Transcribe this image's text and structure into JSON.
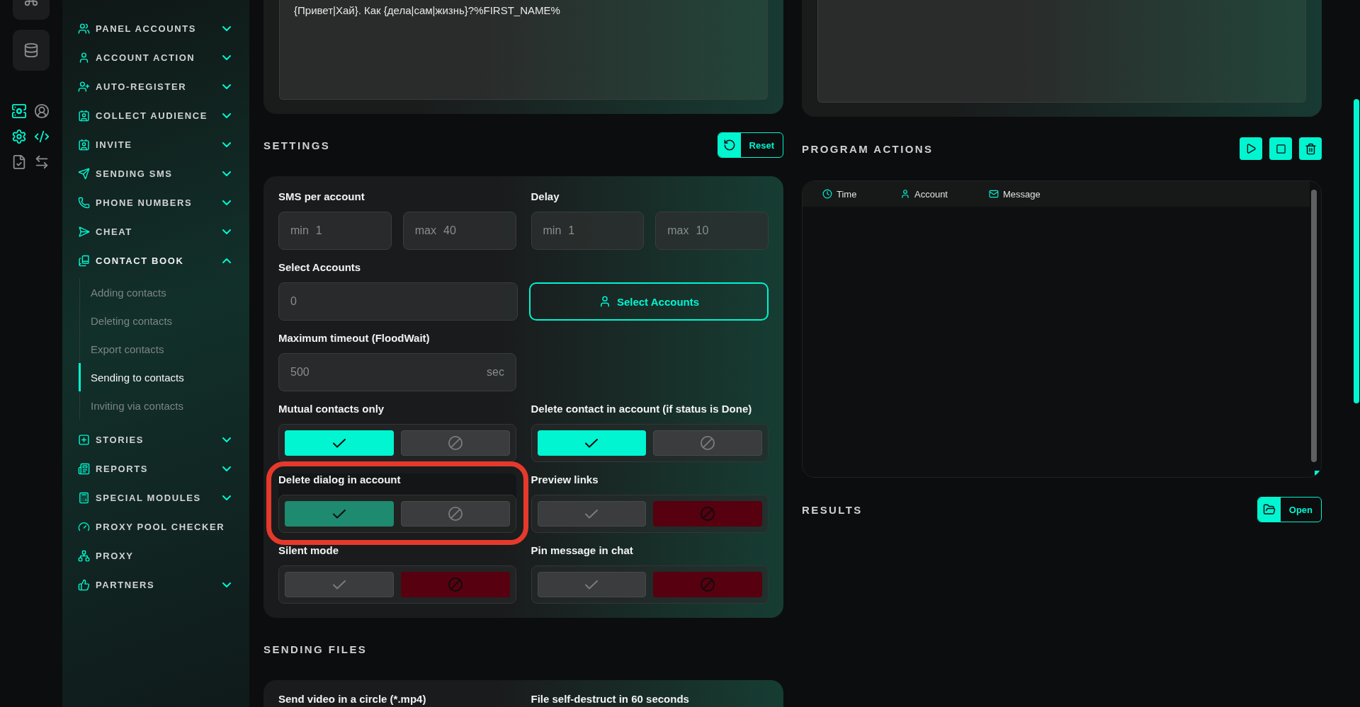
{
  "rail": {
    "icons": [
      {
        "active": false
      },
      {
        "active": false
      },
      {
        "active": true
      },
      {
        "active": false
      },
      {
        "active": true
      },
      {
        "active": true
      },
      {
        "active": false
      },
      {
        "active": false
      }
    ]
  },
  "sidebar": {
    "items": [
      {
        "label": "PANEL ACCOUNTS",
        "expandable": true,
        "expanded": false
      },
      {
        "label": "ACCOUNT ACTION",
        "expandable": true,
        "expanded": false
      },
      {
        "label": "AUTO-REGISTER",
        "expandable": true,
        "expanded": false
      },
      {
        "label": "COLLECT AUDIENCE",
        "expandable": true,
        "expanded": false
      },
      {
        "label": "INVITE",
        "expandable": true,
        "expanded": false
      },
      {
        "label": "SENDING SMS",
        "expandable": true,
        "expanded": false
      },
      {
        "label": "PHONE NUMBERS",
        "expandable": true,
        "expanded": false
      },
      {
        "label": "CHEAT",
        "expandable": true,
        "expanded": false
      },
      {
        "label": "CONTACT BOOK",
        "expandable": true,
        "expanded": true,
        "children": [
          {
            "label": "Adding contacts",
            "selected": false
          },
          {
            "label": "Deleting contacts",
            "selected": false
          },
          {
            "label": "Export contacts",
            "selected": false
          },
          {
            "label": "Sending to contacts",
            "selected": true
          },
          {
            "label": "Inviting via contacts",
            "selected": false
          }
        ]
      },
      {
        "label": "STORIES",
        "expandable": true,
        "expanded": false
      },
      {
        "label": "REPORTS",
        "expandable": true,
        "expanded": false
      },
      {
        "label": "SPECIAL MODULES",
        "expandable": true,
        "expanded": false
      },
      {
        "label": "PROXY POOL CHECKER",
        "expandable": false
      },
      {
        "label": "PROXY",
        "expandable": false
      },
      {
        "label": "PARTNERS",
        "expandable": true,
        "expanded": false
      }
    ]
  },
  "message_editor": {
    "value": "{Привет|Хай}. Как {дела|сам|жизнь}?%FIRST_NAME%"
  },
  "settings": {
    "title": "SETTINGS",
    "reset_button": "Reset",
    "fields": [
      {
        "kind": "range",
        "label": "SMS per account",
        "inputs": [
          {
            "prefix": "min",
            "placeholder": "1"
          },
          {
            "prefix": "max",
            "placeholder": "40"
          }
        ]
      },
      {
        "kind": "range",
        "label": "Delay",
        "inputs": [
          {
            "prefix": "min",
            "placeholder": "1"
          },
          {
            "prefix": "max",
            "placeholder": "10"
          }
        ]
      },
      {
        "kind": "picker",
        "label": "Select Accounts",
        "placeholder": "0",
        "button": "Select Accounts"
      },
      {
        "kind": "number",
        "label": "Maximum timeout (FloodWait)",
        "placeholder": "500",
        "suffix": "sec"
      },
      {
        "kind": "toggle",
        "label": "Mutual contacts only",
        "enabled": true,
        "dimmed": false,
        "highlighted": false
      },
      {
        "kind": "toggle",
        "label": "Delete contact in account (if status is Done)",
        "enabled": true,
        "dimmed": false,
        "highlighted": false
      },
      {
        "kind": "toggle",
        "label": "Delete dialog in account",
        "enabled": true,
        "dimmed": true,
        "highlighted": true
      },
      {
        "kind": "toggle",
        "label": "Preview links",
        "enabled": false,
        "dimmed": false,
        "highlighted": false
      },
      {
        "kind": "toggle",
        "label": "Silent mode",
        "enabled": false,
        "dimmed": false,
        "highlighted": false
      },
      {
        "kind": "toggle",
        "label": "Pin message in chat",
        "enabled": false,
        "dimmed": false,
        "highlighted": false
      }
    ]
  },
  "sending_files": {
    "title": "SENDING FILES",
    "fields": [
      "Send video in a circle (*.mp4)",
      "File self-destruct in 60 seconds"
    ]
  },
  "program_actions": {
    "title": "PROGRAM ACTIONS",
    "columns": [
      "Time",
      "Account",
      "Message"
    ]
  },
  "results": {
    "title": "RESULTS",
    "open_button": "Open"
  }
}
